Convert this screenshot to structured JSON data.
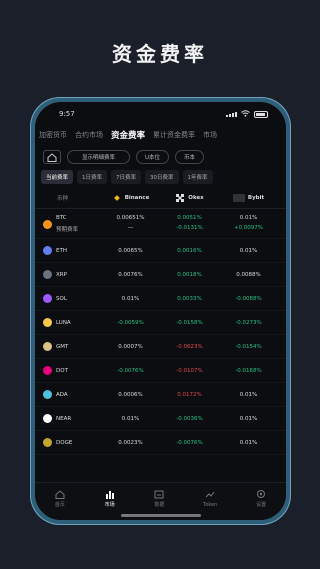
{
  "headline": "资金费率",
  "status": {
    "time": "9:57"
  },
  "tabs": [
    "加密货币",
    "合约市场",
    "资金费率",
    "累计资金费率",
    "市场"
  ],
  "active_tab": 2,
  "controls": {
    "pill1": "显示明细费率",
    "pill2": "U本位",
    "pill3": "币本"
  },
  "periods": [
    "当前费率",
    "1日费率",
    "7日费率",
    "30日费率",
    "1年费率"
  ],
  "active_period": 0,
  "exchange_header": {
    "coin_label": "币种",
    "exchanges": [
      "Binance",
      "Okex",
      "Bybit"
    ]
  },
  "coins": [
    {
      "symbol": "BTC",
      "sub": "预期费率",
      "color": "#f7931a",
      "v1": "0.00651%",
      "v1s": "—",
      "v2": "0.0051%",
      "v2s": "-0.0131%",
      "v3": "0.01%",
      "v3s": "+0.0097%",
      "c2": "pos",
      "c2s": "pos",
      "c3": "",
      "c3s": "pos"
    },
    {
      "symbol": "ETH",
      "color": "#627eea",
      "v1": "0.0065%",
      "v2": "0.0016%",
      "v3": "0.01%",
      "c2": "pos",
      "c3": ""
    },
    {
      "symbol": "XRP",
      "color": "#6a7280",
      "v1": "0.0076%",
      "v2": "0.0018%",
      "v3": "0.0088%",
      "c2": "pos",
      "c3": ""
    },
    {
      "symbol": "SOL",
      "color": "#9b59ff",
      "v1": "0.01%",
      "v2": "0.0033%",
      "v3": "-0.0088%",
      "c2": "pos",
      "c3": "pos"
    },
    {
      "symbol": "LUNA",
      "color": "#f5c84c",
      "v1": "-0.0059%",
      "v2": "-0.0158%",
      "v3": "-0.0273%",
      "c1": "pos",
      "c2": "pos",
      "c3": "pos"
    },
    {
      "symbol": "GMT",
      "color": "#d9c38a",
      "v1": "0.0007%",
      "v2": "-0.0623%",
      "v3": "-0.0154%",
      "c2": "neg",
      "c3": "pos"
    },
    {
      "symbol": "DOT",
      "color": "#e6007a",
      "v1": "-0.0076%",
      "v2": "-0.0107%",
      "v3": "-0.0168%",
      "c1": "pos",
      "c2": "neg",
      "c3": "pos"
    },
    {
      "symbol": "ADA",
      "color": "#4cc3d9",
      "v1": "0.0006%",
      "v2": "0.0172%",
      "v3": "0.01%",
      "c2": "neg",
      "c3": ""
    },
    {
      "symbol": "NEAR",
      "color": "#ffffff",
      "v1": "0.01%",
      "v2": "-0.0036%",
      "v3": "0.01%",
      "c2": "pos",
      "c3": ""
    },
    {
      "symbol": "DOGE",
      "color": "#c2a633",
      "v1": "0.0023%",
      "v2": "-0.0076%",
      "v3": "0.01%",
      "c2": "pos",
      "c3": ""
    }
  ],
  "nav": [
    "首页",
    "市场",
    "数据",
    "Token",
    "设置"
  ],
  "active_nav": 1,
  "colors": {
    "background": "#1a1f29",
    "phone_frame": "#2f5f78",
    "positive": "#26c281",
    "negative": "#e5484d"
  }
}
